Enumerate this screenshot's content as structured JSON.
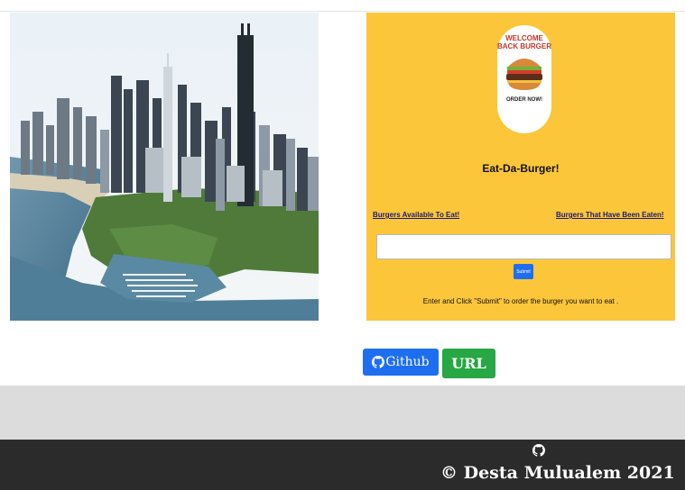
{
  "project_left": {
    "image_name": "chicago-skyline-photo"
  },
  "project_right": {
    "screenshot": {
      "logo_text_top": "WELCOME BACK BURGER",
      "logo_text_bottom": "ORDER NOW!",
      "title": "Eat-Da-Burger!",
      "col_left": "Burgers Available To Eat!",
      "col_right": "Burgers That Have Been Eaten!",
      "submit_label": "Submit",
      "hint": "Enter and Click \"Submit\" to order the burger you want to eat ."
    }
  },
  "buttons": {
    "github_label": "Github",
    "url_label": "URL"
  },
  "footer": {
    "icon": "github-icon",
    "copyright": "© Desta Mulualem 2021"
  },
  "colors": {
    "github_button": "#1e6ff0",
    "url_button": "#28a745",
    "footer_bg": "#2b2b2b",
    "burger_bg": "#fcc63a"
  }
}
